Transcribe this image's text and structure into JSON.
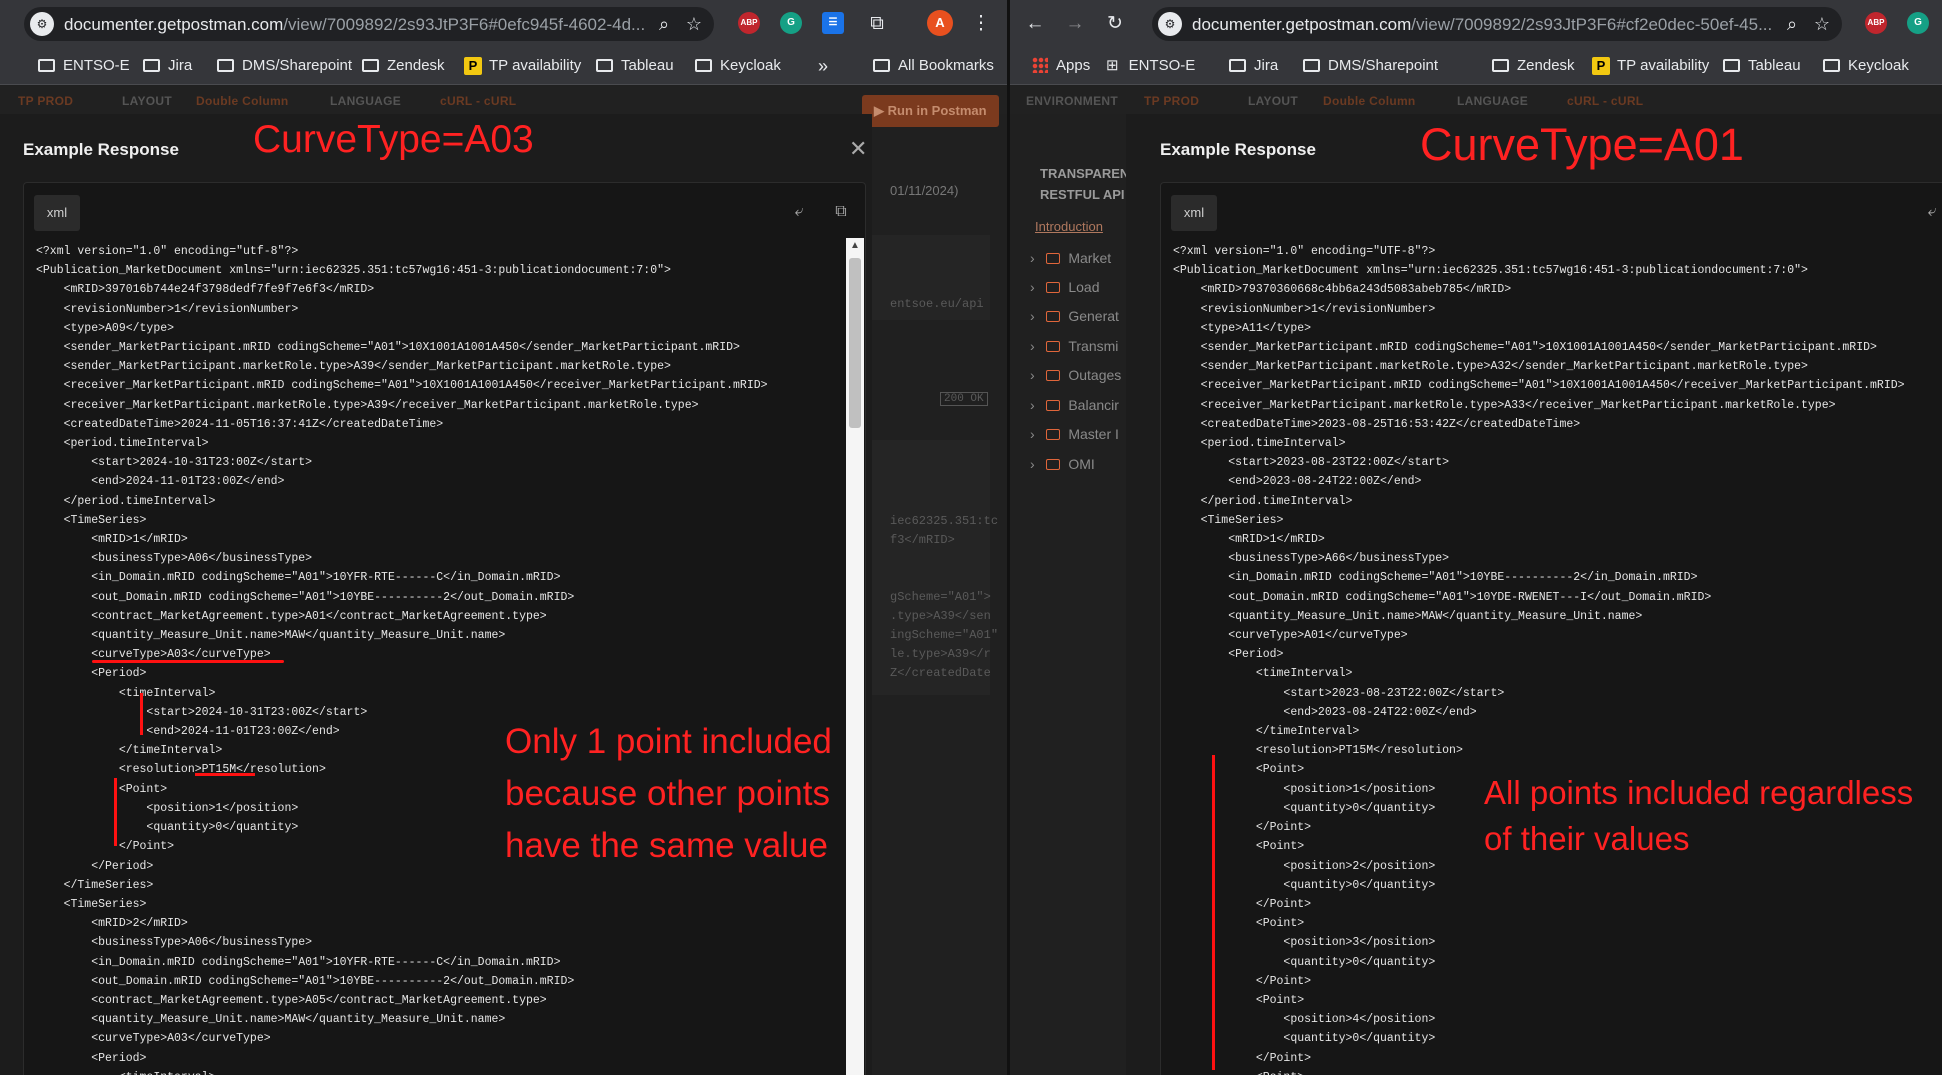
{
  "left": {
    "url_host": "documenter.getpostman.com",
    "url_path": "/view/7009892/2s93JtP3F6#0efc945f-4602-4d...",
    "ext_abp": "ABP",
    "avatar_letter": "A",
    "bookmarks": [
      "ENTSO-E",
      "Jira",
      "DMS/Sharepoint",
      "Zendesk",
      "TP availability",
      "Tableau",
      "Keycloak"
    ],
    "bookmarks_overflow": "»",
    "all_bookmarks": "All Bookmarks",
    "toolbar": [
      "TP PROD",
      "LAYOUT",
      "Double Column",
      "LANGUAGE",
      "cURL - cURL"
    ],
    "run_button": "Run in Postman",
    "bg_date": "01/11/2024)",
    "bg_url": "entsoe.eu/api",
    "bg_status": "200 OK",
    "bg_code": [
      "iec62325.351:tc",
      "f3</mRID>",
      "",
      "",
      "gScheme=\"A01\">",
      ".type>A39</sen",
      "ingScheme=\"A01\"",
      "le.type>A39</r",
      "Z</createdDate"
    ],
    "modal_title": "Example Response",
    "language_chip": "xml",
    "annotation_title": "CurveType=A03",
    "annotation_note": [
      "Only 1 point included",
      "because other points",
      "have the same value"
    ],
    "code": [
      "<?xml version=\"1.0\" encoding=\"utf-8\"?>",
      "<Publication_MarketDocument xmlns=\"urn:iec62325.351:tc57wg16:451-3:publicationdocument:7:0\">",
      "    <mRID>397016b744e24f3798dedf7fe9f7e6f3</mRID>",
      "    <revisionNumber>1</revisionNumber>",
      "    <type>A09</type>",
      "    <sender_MarketParticipant.mRID codingScheme=\"A01\">10X1001A1001A450</sender_MarketParticipant.mRID>",
      "    <sender_MarketParticipant.marketRole.type>A39</sender_MarketParticipant.marketRole.type>",
      "    <receiver_MarketParticipant.mRID codingScheme=\"A01\">10X1001A1001A450</receiver_MarketParticipant.mRID>",
      "    <receiver_MarketParticipant.marketRole.type>A39</receiver_MarketParticipant.marketRole.type>",
      "    <createdDateTime>2024-11-05T16:37:41Z</createdDateTime>",
      "    <period.timeInterval>",
      "        <start>2024-10-31T23:00Z</start>",
      "        <end>2024-11-01T23:00Z</end>",
      "    </period.timeInterval>",
      "    <TimeSeries>",
      "        <mRID>1</mRID>",
      "        <businessType>A06</businessType>",
      "        <in_Domain.mRID codingScheme=\"A01\">10YFR-RTE------C</in_Domain.mRID>",
      "        <out_Domain.mRID codingScheme=\"A01\">10YBE----------2</out_Domain.mRID>",
      "        <contract_MarketAgreement.type>A01</contract_MarketAgreement.type>",
      "        <quantity_Measure_Unit.name>MAW</quantity_Measure_Unit.name>",
      "        <curveType>A03</curveType>",
      "        <Period>",
      "            <timeInterval>",
      "                <start>2024-10-31T23:00Z</start>",
      "                <end>2024-11-01T23:00Z</end>",
      "            </timeInterval>",
      "            <resolution>PT15M</resolution>",
      "            <Point>",
      "                <position>1</position>",
      "                <quantity>0</quantity>",
      "            </Point>",
      "        </Period>",
      "    </TimeSeries>",
      "    <TimeSeries>",
      "        <mRID>2</mRID>",
      "        <businessType>A06</businessType>",
      "        <in_Domain.mRID codingScheme=\"A01\">10YFR-RTE------C</in_Domain.mRID>",
      "        <out_Domain.mRID codingScheme=\"A01\">10YBE----------2</out_Domain.mRID>",
      "        <contract_MarketAgreement.type>A05</contract_MarketAgreement.type>",
      "        <quantity_Measure_Unit.name>MAW</quantity_Measure_Unit.name>",
      "        <curveType>A03</curveType>",
      "        <Period>",
      "            <timeInterval>"
    ]
  },
  "right": {
    "url_host": "documenter.getpostman.com",
    "url_path": "/view/7009892/2s93JtP3F6#cf2e0dec-50ef-45...",
    "ext_abp": "ABP",
    "bookmarks": [
      "Apps",
      "ENTSO-E",
      "Jira",
      "DMS/Sharepoint",
      "Zendesk",
      "TP availability",
      "Tableau",
      "Keycloak"
    ],
    "toolbar": [
      "ENVIRONMENT",
      "TP PROD",
      "LAYOUT",
      "Double Column",
      "LANGUAGE",
      "cURL - cURL"
    ],
    "sidebar_title": [
      "TRANSPAREN",
      "RESTFUL API"
    ],
    "sidebar_intro": "Introduction",
    "sidebar_items": [
      "Market",
      "Load",
      "Generat",
      "Transmi",
      "Outages",
      "Balancir",
      "Master I",
      "OMI"
    ],
    "modal_title": "Example Response",
    "language_chip": "xml",
    "annotation_title": "CurveType=A01",
    "annotation_note": [
      "All points included regardless",
      "of their values"
    ],
    "code": [
      "<?xml version=\"1.0\" encoding=\"UTF-8\"?>",
      "<Publication_MarketDocument xmlns=\"urn:iec62325.351:tc57wg16:451-3:publicationdocument:7:0\">",
      "    <mRID>79370360668c4bb6a243d5083abeb785</mRID>",
      "    <revisionNumber>1</revisionNumber>",
      "    <type>A11</type>",
      "    <sender_MarketParticipant.mRID codingScheme=\"A01\">10X1001A1001A450</sender_MarketParticipant.mRID>",
      "    <sender_MarketParticipant.marketRole.type>A32</sender_MarketParticipant.marketRole.type>",
      "    <receiver_MarketParticipant.mRID codingScheme=\"A01\">10X1001A1001A450</receiver_MarketParticipant.mRID>",
      "    <receiver_MarketParticipant.marketRole.type>A33</receiver_MarketParticipant.marketRole.type>",
      "    <createdDateTime>2023-08-25T16:53:42Z</createdDateTime>",
      "    <period.timeInterval>",
      "        <start>2023-08-23T22:00Z</start>",
      "        <end>2023-08-24T22:00Z</end>",
      "    </period.timeInterval>",
      "    <TimeSeries>",
      "        <mRID>1</mRID>",
      "        <businessType>A66</businessType>",
      "        <in_Domain.mRID codingScheme=\"A01\">10YBE----------2</in_Domain.mRID>",
      "        <out_Domain.mRID codingScheme=\"A01\">10YDE-RWENET---I</out_Domain.mRID>",
      "        <quantity_Measure_Unit.name>MAW</quantity_Measure_Unit.name>",
      "        <curveType>A01</curveType>",
      "        <Period>",
      "            <timeInterval>",
      "                <start>2023-08-23T22:00Z</start>",
      "                <end>2023-08-24T22:00Z</end>",
      "            </timeInterval>",
      "            <resolution>PT15M</resolution>",
      "            <Point>",
      "                <position>1</position>",
      "                <quantity>0</quantity>",
      "            </Point>",
      "            <Point>",
      "                <position>2</position>",
      "                <quantity>0</quantity>",
      "            </Point>",
      "            <Point>",
      "                <position>3</position>",
      "                <quantity>0</quantity>",
      "            </Point>",
      "            <Point>",
      "                <position>4</position>",
      "                <quantity>0</quantity>",
      "            </Point>",
      "            <Point>"
    ]
  }
}
